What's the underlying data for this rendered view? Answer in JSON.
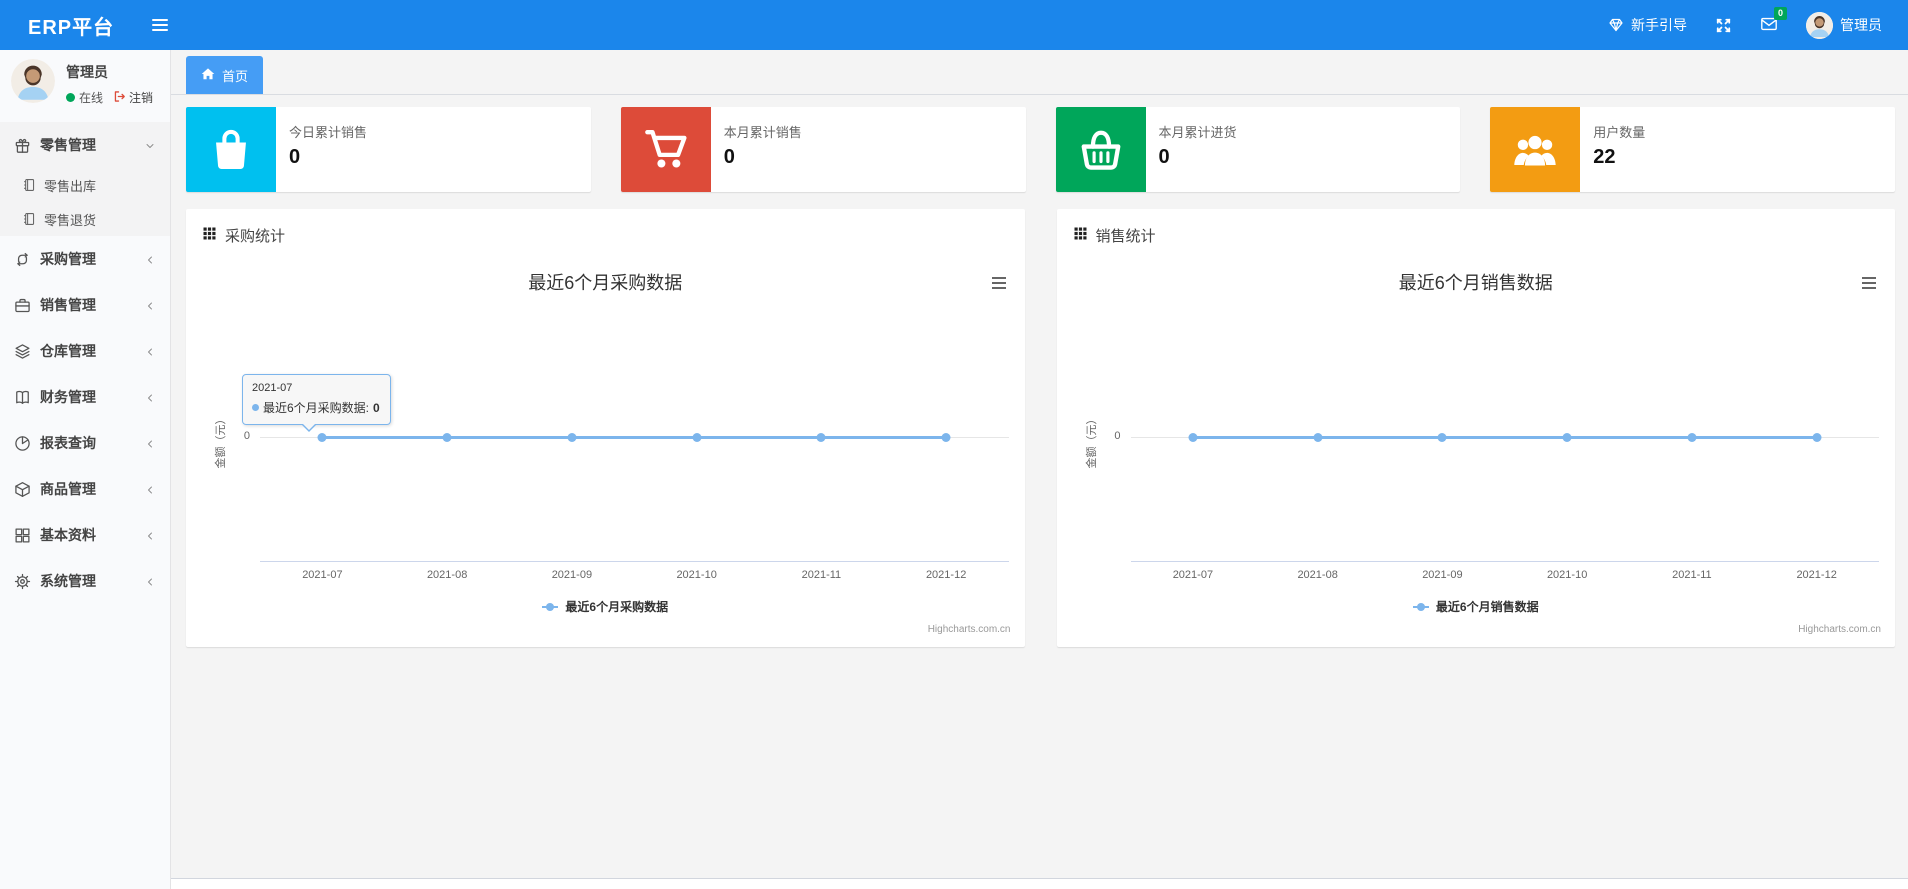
{
  "navbar": {
    "brand": "ERP平台",
    "guide_label": "新手引导",
    "mail_badge": "0",
    "username": "管理员"
  },
  "sidebar": {
    "user": {
      "name": "管理员",
      "status_label": "在线",
      "logout_label": "注销"
    },
    "items": [
      {
        "key": "retail-management",
        "label": "零售管理",
        "icon": "gift-icon",
        "state": "expanded",
        "children": [
          {
            "key": "retail-outbound",
            "label": "零售出库",
            "icon": "journal-icon"
          },
          {
            "key": "retail-return",
            "label": "零售退货",
            "icon": "journal-icon"
          }
        ]
      },
      {
        "key": "purchase-management",
        "label": "采购管理",
        "icon": "loop-icon",
        "state": "collapsed"
      },
      {
        "key": "sales-management",
        "label": "销售管理",
        "icon": "briefcase-icon",
        "state": "collapsed"
      },
      {
        "key": "warehouse-management",
        "label": "仓库管理",
        "icon": "layers-icon",
        "state": "collapsed"
      },
      {
        "key": "finance-management",
        "label": "财务管理",
        "icon": "book-icon",
        "state": "collapsed"
      },
      {
        "key": "report-query",
        "label": "报表查询",
        "icon": "pie-chart-icon",
        "state": "collapsed"
      },
      {
        "key": "goods-management",
        "label": "商品管理",
        "icon": "cube-icon",
        "state": "collapsed"
      },
      {
        "key": "basic-data",
        "label": "基本资料",
        "icon": "grid-icon",
        "state": "collapsed"
      },
      {
        "key": "system-management",
        "label": "系统管理",
        "icon": "gear-icon",
        "state": "collapsed"
      }
    ]
  },
  "tabs": [
    {
      "key": "home",
      "label": "首页",
      "icon": "home-icon",
      "active": true
    }
  ],
  "stat_cards": [
    {
      "key": "today-sales",
      "label": "今日累计销售",
      "value": "0",
      "color": "#00c0ef",
      "icon": "shopping-bag-icon"
    },
    {
      "key": "month-sales",
      "label": "本月累计销售",
      "value": "0",
      "color": "#dd4b39",
      "icon": "shopping-cart-icon"
    },
    {
      "key": "month-purchase",
      "label": "本月累计进货",
      "value": "0",
      "color": "#00a65a",
      "icon": "shopping-basket-icon"
    },
    {
      "key": "user-count",
      "label": "用户数量",
      "value": "22",
      "color": "#f39c12",
      "icon": "users-icon"
    }
  ],
  "panels": [
    {
      "key": "purchase-stats",
      "title": "采购统计"
    },
    {
      "key": "sales-stats",
      "title": "销售统计"
    }
  ],
  "chart_data": [
    {
      "type": "line",
      "title": "最近6个月采购数据",
      "categories": [
        "2021-07",
        "2021-08",
        "2021-09",
        "2021-10",
        "2021-11",
        "2021-12"
      ],
      "series": [
        {
          "name": "最近6个月采购数据",
          "values": [
            0,
            0,
            0,
            0,
            0,
            0
          ],
          "color": "#7cb5ec"
        }
      ],
      "xlabel": "",
      "ylabel": "金额（元）",
      "yticks": [
        "0"
      ],
      "ylim": [
        0,
        0
      ],
      "grid": true,
      "legend_position": "bottom",
      "credit": "Highcharts.com.cn",
      "tooltip": {
        "visible": true,
        "point_index": 0,
        "category": "2021-07",
        "series": "最近6个月采购数据",
        "value": "0"
      }
    },
    {
      "type": "line",
      "title": "最近6个月销售数据",
      "categories": [
        "2021-07",
        "2021-08",
        "2021-09",
        "2021-10",
        "2021-11",
        "2021-12"
      ],
      "series": [
        {
          "name": "最近6个月销售数据",
          "values": [
            0,
            0,
            0,
            0,
            0,
            0
          ],
          "color": "#7cb5ec"
        }
      ],
      "xlabel": "",
      "ylabel": "金额（元）",
      "yticks": [
        "0"
      ],
      "ylim": [
        0,
        0
      ],
      "grid": true,
      "legend_position": "bottom",
      "credit": "Highcharts.com.cn",
      "tooltip": {
        "visible": false
      }
    }
  ],
  "colors": {
    "navbar": "#1b86eb",
    "tab_active": "#459df5",
    "series": "#7cb5ec",
    "badge_green": "#00a65a"
  }
}
